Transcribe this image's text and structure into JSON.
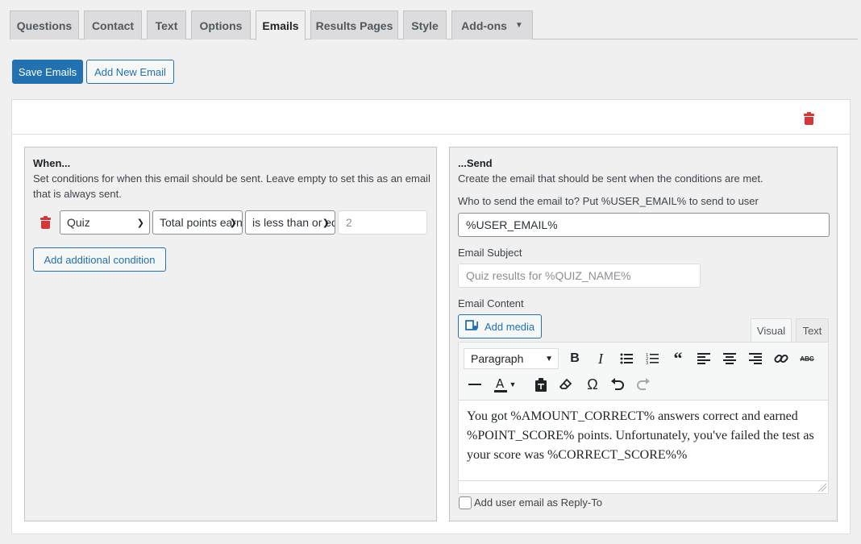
{
  "tabs": [
    {
      "label": "Questions",
      "active": false
    },
    {
      "label": "Contact",
      "active": false
    },
    {
      "label": "Text",
      "active": false
    },
    {
      "label": "Options",
      "active": false
    },
    {
      "label": "Emails",
      "active": true
    },
    {
      "label": "Results Pages",
      "active": false
    },
    {
      "label": "Style",
      "active": false
    },
    {
      "label": "Add-ons",
      "active": false,
      "dropdown": true
    }
  ],
  "actions": {
    "save_label": "Save Emails",
    "add_label": "Add New Email"
  },
  "when": {
    "heading": "When...",
    "description": "Set conditions for when this email should be sent. Leave empty to set this as an email that is always sent.",
    "condition": {
      "category": "Quiz",
      "criteria": "Total points earned",
      "operator": "is less than or equal to",
      "value": "2"
    },
    "add_condition_label": "Add additional condition"
  },
  "send": {
    "heading": "...Send",
    "description": "Create the email that should be sent when the conditions are met.",
    "to_label": "Who to send the email to? Put %USER_EMAIL% to send to user",
    "to_value": "%USER_EMAIL%",
    "subject_label": "Email Subject",
    "subject_placeholder": "Quiz results for %QUIZ_NAME%",
    "content_label": "Email Content",
    "add_media_label": "Add media",
    "tab_visual": "Visual",
    "tab_text": "Text",
    "format_select": "Paragraph",
    "content": "You got %AMOUNT_CORRECT% answers correct and earned %POINT_SCORE% points. Unfortunately, you've failed the test as your score was %CORRECT_SCORE%%",
    "reply_to_label": "Add user email as Reply-To",
    "reply_to_checked": false
  },
  "colors": {
    "primary": "#2271b1",
    "danger": "#d63638",
    "background": "#f0f0f1"
  },
  "icons": [
    "trash-icon",
    "add-media-icon",
    "bold-icon",
    "italic-icon",
    "bullet-list-icon",
    "numbered-list-icon",
    "blockquote-icon",
    "align-left-icon",
    "align-center-icon",
    "align-right-icon",
    "link-icon",
    "strikethrough-icon",
    "horizontal-rule-icon",
    "text-color-icon",
    "paste-text-icon",
    "clear-formatting-icon",
    "special-character-icon",
    "undo-icon",
    "redo-icon",
    "resize-handle-icon"
  ]
}
